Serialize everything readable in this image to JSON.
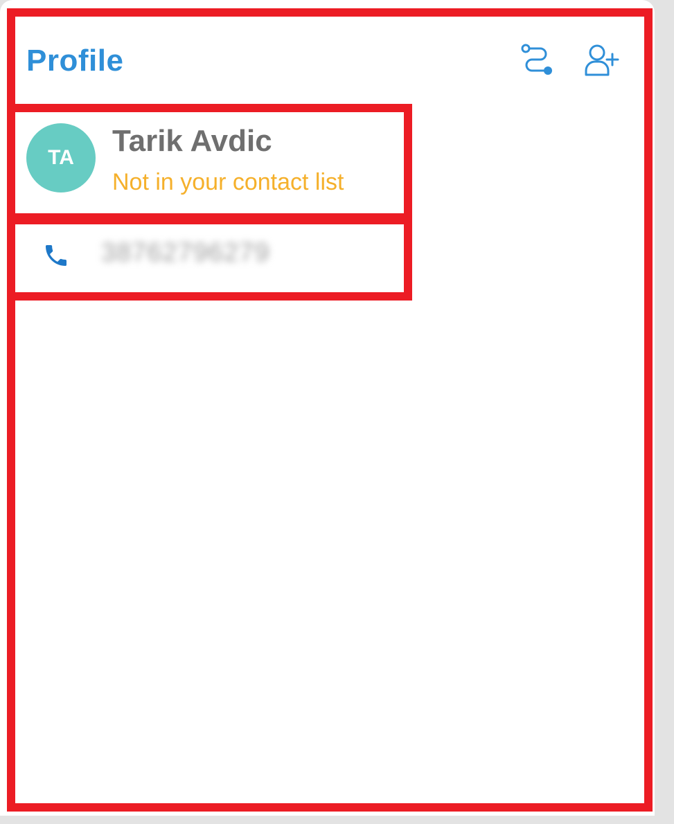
{
  "header": {
    "title": "Profile",
    "actions": [
      {
        "icon": "route-icon"
      },
      {
        "icon": "add-contact-icon"
      }
    ]
  },
  "contact": {
    "initials": "TA",
    "name": "Tarik Avdic",
    "status": "Not in your contact list"
  },
  "phone": {
    "icon": "phone-icon",
    "number": "38762796279"
  },
  "colors": {
    "accent": "#2f8fd8",
    "avatar": "#67ccc3",
    "status": "#f5b02b",
    "annotation": "#ec1c24"
  }
}
